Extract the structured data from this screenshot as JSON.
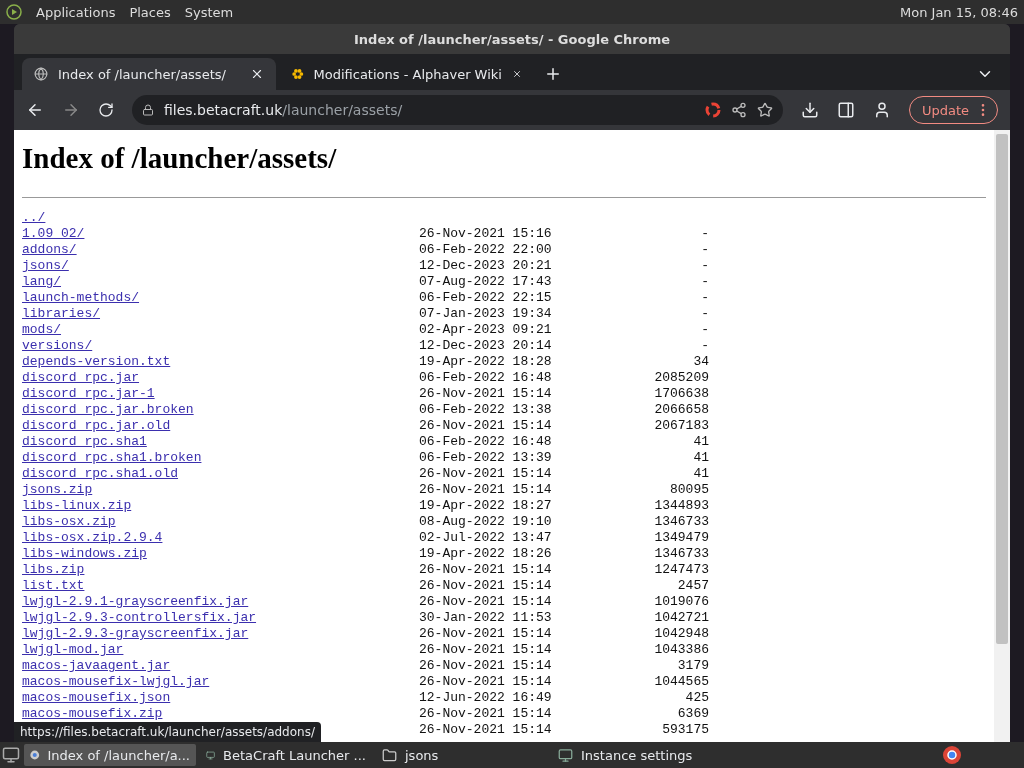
{
  "top_panel": {
    "menus": [
      "Applications",
      "Places",
      "System"
    ],
    "clock": "Mon Jan 15, 08:46"
  },
  "window": {
    "title": "Index of /launcher/assets/ - Google Chrome"
  },
  "tabs": [
    {
      "label": "Index of /launcher/assets/",
      "selected": true,
      "kind": "globe"
    },
    {
      "label": "Modifications - Alphaver Wiki",
      "selected": false,
      "kind": "flower"
    }
  ],
  "address": {
    "host": "files.betacraft.uk",
    "path": "/launcher/assets/"
  },
  "update_button": "Update",
  "page": {
    "heading": "Index of /launcher/assets/",
    "parent_link": "../",
    "rows": [
      {
        "name": "1.09_02/",
        "date": "26-Nov-2021 15:16",
        "size": "-"
      },
      {
        "name": "addons/",
        "date": "06-Feb-2022 22:00",
        "size": "-"
      },
      {
        "name": "jsons/",
        "date": "12-Dec-2023 20:21",
        "size": "-"
      },
      {
        "name": "lang/",
        "date": "07-Aug-2022 17:43",
        "size": "-"
      },
      {
        "name": "launch-methods/",
        "date": "06-Feb-2022 22:15",
        "size": "-"
      },
      {
        "name": "libraries/",
        "date": "07-Jan-2023 19:34",
        "size": "-"
      },
      {
        "name": "mods/",
        "date": "02-Apr-2023 09:21",
        "size": "-"
      },
      {
        "name": "versions/",
        "date": "12-Dec-2023 20:14",
        "size": "-"
      },
      {
        "name": "depends-version.txt",
        "date": "19-Apr-2022 18:28",
        "size": "34"
      },
      {
        "name": "discord_rpc.jar",
        "date": "06-Feb-2022 16:48",
        "size": "2085209"
      },
      {
        "name": "discord_rpc.jar-1",
        "date": "26-Nov-2021 15:14",
        "size": "1706638"
      },
      {
        "name": "discord_rpc.jar.broken",
        "date": "06-Feb-2022 13:38",
        "size": "2066658"
      },
      {
        "name": "discord_rpc.jar.old",
        "date": "26-Nov-2021 15:14",
        "size": "2067183"
      },
      {
        "name": "discord_rpc.sha1",
        "date": "06-Feb-2022 16:48",
        "size": "41"
      },
      {
        "name": "discord_rpc.sha1.broken",
        "date": "06-Feb-2022 13:39",
        "size": "41"
      },
      {
        "name": "discord_rpc.sha1.old",
        "date": "26-Nov-2021 15:14",
        "size": "41"
      },
      {
        "name": "jsons.zip",
        "date": "26-Nov-2021 15:14",
        "size": "80095"
      },
      {
        "name": "libs-linux.zip",
        "date": "19-Apr-2022 18:27",
        "size": "1344893"
      },
      {
        "name": "libs-osx.zip",
        "date": "08-Aug-2022 19:10",
        "size": "1346733"
      },
      {
        "name": "libs-osx.zip.2.9.4",
        "date": "02-Jul-2022 13:47",
        "size": "1349479"
      },
      {
        "name": "libs-windows.zip",
        "date": "19-Apr-2022 18:26",
        "size": "1346733"
      },
      {
        "name": "libs.zip",
        "date": "26-Nov-2021 15:14",
        "size": "1247473"
      },
      {
        "name": "list.txt",
        "date": "26-Nov-2021 15:14",
        "size": "2457"
      },
      {
        "name": "lwjgl-2.9.1-grayscreenfix.jar",
        "date": "26-Nov-2021 15:14",
        "size": "1019076"
      },
      {
        "name": "lwjgl-2.9.3-controllersfix.jar",
        "date": "30-Jan-2022 11:53",
        "size": "1042721"
      },
      {
        "name": "lwjgl-2.9.3-grayscreenfix.jar",
        "date": "26-Nov-2021 15:14",
        "size": "1042948"
      },
      {
        "name": "lwjgl-mod.jar",
        "date": "26-Nov-2021 15:14",
        "size": "1043386"
      },
      {
        "name": "macos-javaagent.jar",
        "date": "26-Nov-2021 15:14",
        "size": "3179"
      },
      {
        "name": "macos-mousefix-lwjgl.jar",
        "date": "26-Nov-2021 15:14",
        "size": "1044565"
      },
      {
        "name": "macos-mousefix.json",
        "date": "12-Jun-2022 16:49",
        "size": "425"
      },
      {
        "name": "macos-mousefix.zip",
        "date": "26-Nov-2021 15:14",
        "size": "6369"
      },
      {
        "date": "26-Nov-2021 15:14",
        "size": "593175"
      }
    ]
  },
  "status_url": "https://files.betacraft.uk/launcher/assets/addons/",
  "taskbar": [
    {
      "label": "Index of /launcher/a...",
      "selected": true,
      "kind": "chrome"
    },
    {
      "label": "BetaCraft Launcher ...",
      "selected": false,
      "kind": "app"
    },
    {
      "label": "jsons",
      "selected": false,
      "kind": "folder"
    },
    {
      "label": "Instance settings",
      "selected": false,
      "kind": "app"
    }
  ]
}
